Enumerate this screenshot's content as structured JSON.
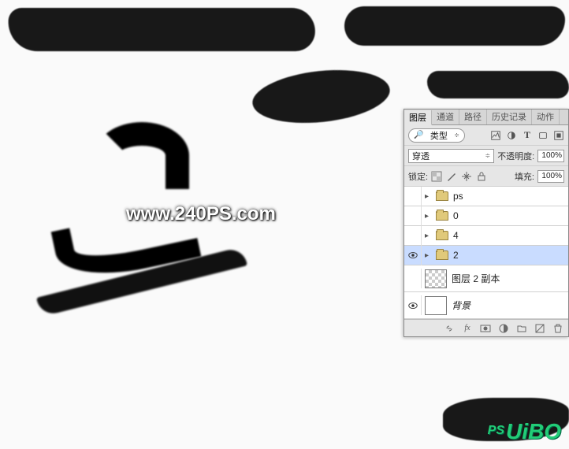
{
  "watermark": "www.240PS.com",
  "logo_small": "PS",
  "logo_main": "UiBO",
  "panel": {
    "tabs": [
      "图层",
      "通道",
      "路径",
      "历史记录",
      "动作"
    ],
    "active_tab_index": 0,
    "filter": {
      "mag": "🔎",
      "label": "类型",
      "caret": "≑"
    },
    "type_icons": [
      "image-icon",
      "adjust-icon",
      "text-icon",
      "shape-icon",
      "smart-icon"
    ],
    "blend_mode": "穿透",
    "opacity_label": "不透明度:",
    "opacity_value": "100%",
    "lock_label": "锁定:",
    "fill_label": "填充:",
    "fill_value": "100%",
    "layers": [
      {
        "visible": false,
        "type": "group",
        "name": "ps",
        "selected": false
      },
      {
        "visible": false,
        "type": "group",
        "name": "0",
        "selected": false
      },
      {
        "visible": false,
        "type": "group",
        "name": "4",
        "selected": false
      },
      {
        "visible": true,
        "type": "group",
        "name": "2",
        "selected": true
      },
      {
        "visible": false,
        "type": "layer",
        "name": "图层 2 副本",
        "selected": false,
        "thumb": "checker"
      },
      {
        "visible": true,
        "type": "layer",
        "name": "背景",
        "selected": false,
        "thumb": "white"
      }
    ],
    "footer_icons": [
      "link-icon",
      "fx-icon",
      "mask-icon",
      "adjustment-icon",
      "group-icon",
      "new-icon",
      "trash-icon"
    ],
    "fx_label": "fx"
  }
}
